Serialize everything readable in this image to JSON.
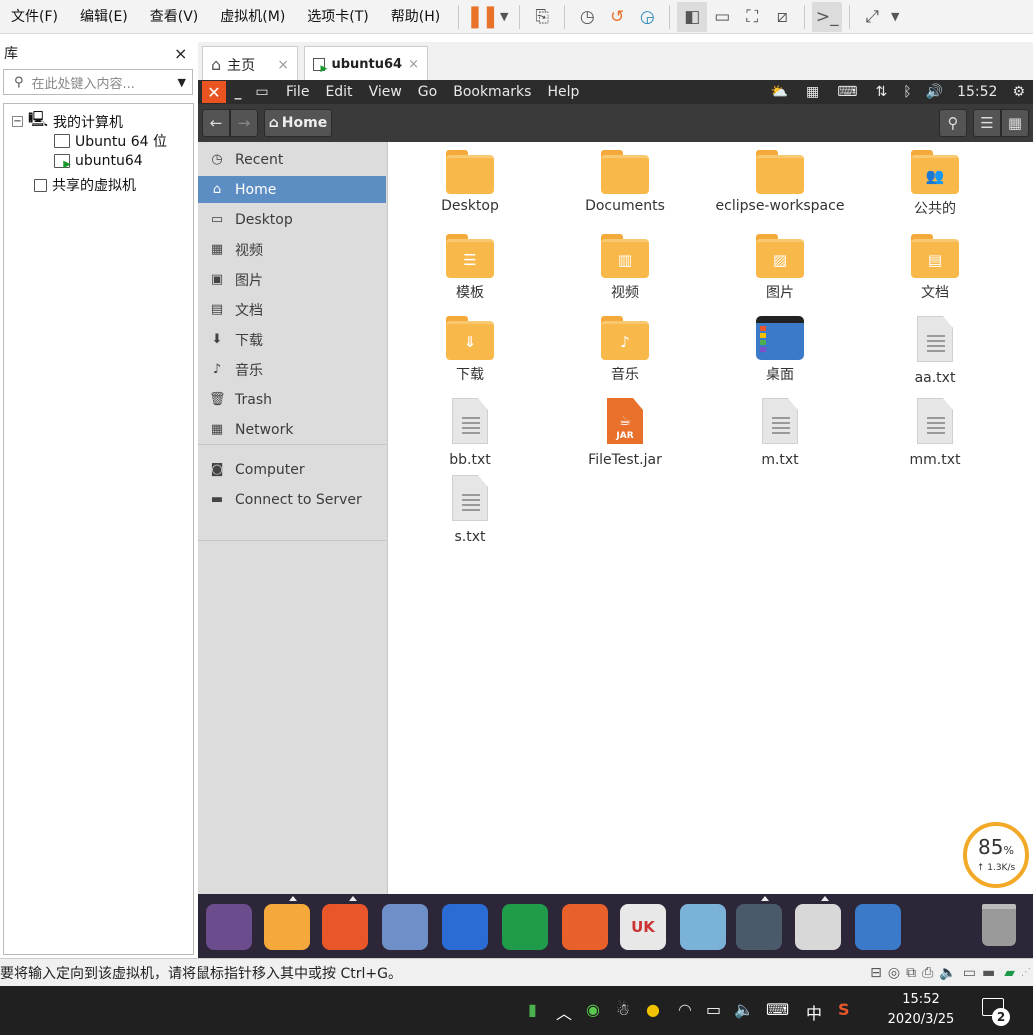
{
  "vm_menu": [
    "文件(F)",
    "编辑(E)",
    "查看(V)",
    "虚拟机(M)",
    "选项卡(T)",
    "帮助(H)"
  ],
  "library": {
    "title": "库",
    "close": "×",
    "search_placeholder": "在此处键入内容...",
    "tree": {
      "root": "我的计算机",
      "vm1": "Ubuntu 64 位",
      "vm2": "ubuntu64",
      "shared": "共享的虚拟机"
    }
  },
  "tabs": {
    "home": "主页",
    "vm": "ubuntu64",
    "close": "×"
  },
  "ubuntu": {
    "menus": [
      "File",
      "Edit",
      "View",
      "Go",
      "Bookmarks",
      "Help"
    ],
    "time": "15:52"
  },
  "nautilus": {
    "path_button": "Home",
    "sidebar": [
      {
        "label": "Recent",
        "icon": "clock-icon",
        "glyph": "◷"
      },
      {
        "label": "Home",
        "icon": "home-icon",
        "glyph": "⌂",
        "active": true
      },
      {
        "label": "Desktop",
        "icon": "desktop-icon",
        "glyph": "▭"
      },
      {
        "label": "视频",
        "icon": "film-icon",
        "glyph": "▦"
      },
      {
        "label": "图片",
        "icon": "image-icon",
        "glyph": "▣"
      },
      {
        "label": "文档",
        "icon": "document-icon",
        "glyph": "▤"
      },
      {
        "label": "下载",
        "icon": "download-icon",
        "glyph": "⬇"
      },
      {
        "label": "音乐",
        "icon": "music-icon",
        "glyph": "♪"
      },
      {
        "label": "Trash",
        "icon": "trash-icon",
        "glyph": "🗑"
      },
      {
        "label": "Network",
        "icon": "network-icon",
        "glyph": "▦"
      },
      {
        "label": "Computer",
        "icon": "computer-icon",
        "glyph": "◙"
      },
      {
        "label": "Connect to Server",
        "icon": "server-icon",
        "glyph": "▬"
      }
    ],
    "files": [
      {
        "name": "Desktop",
        "kind": "folder",
        "emblem": ""
      },
      {
        "name": "Documents",
        "kind": "folder",
        "emblem": ""
      },
      {
        "name": "eclipse-workspace",
        "kind": "folder",
        "emblem": ""
      },
      {
        "name": "公共的",
        "kind": "folder",
        "emblem": "👥"
      },
      {
        "name": "模板",
        "kind": "folder",
        "emblem": "☰"
      },
      {
        "name": "视频",
        "kind": "folder",
        "emblem": "▥"
      },
      {
        "name": "图片",
        "kind": "folder",
        "emblem": "▨"
      },
      {
        "name": "文档",
        "kind": "folder",
        "emblem": "▤"
      },
      {
        "name": "下载",
        "kind": "folder",
        "emblem": "⇓"
      },
      {
        "name": "音乐",
        "kind": "folder",
        "emblem": "♪"
      },
      {
        "name": "桌面",
        "kind": "desktop",
        "emblem": ""
      },
      {
        "name": "aa.txt",
        "kind": "txt",
        "emblem": ""
      },
      {
        "name": "bb.txt",
        "kind": "txt",
        "emblem": ""
      },
      {
        "name": "FileTest.jar",
        "kind": "jar",
        "emblem": "JAR"
      },
      {
        "name": "m.txt",
        "kind": "txt",
        "emblem": ""
      },
      {
        "name": "mm.txt",
        "kind": "txt",
        "emblem": ""
      },
      {
        "name": "s.txt",
        "kind": "txt",
        "emblem": ""
      }
    ]
  },
  "dock": [
    {
      "name": "ubuntu-launcher",
      "color": "#6b4c8c"
    },
    {
      "name": "files",
      "color": "#f6a93b"
    },
    {
      "name": "firefox",
      "color": "#e8562a"
    },
    {
      "name": "chromium",
      "color": "#6f8fc8"
    },
    {
      "name": "word",
      "color": "#2b6cd4"
    },
    {
      "name": "excel",
      "color": "#1f9b4a"
    },
    {
      "name": "powerpoint",
      "color": "#e8602a"
    },
    {
      "name": "uk-software",
      "color": "#e8e8e8",
      "text": "UK"
    },
    {
      "name": "app-store",
      "color": "#7bb3d8"
    },
    {
      "name": "terminal",
      "color": "#4a5a6a"
    },
    {
      "name": "eclipse",
      "color": "#d8d8d8"
    },
    {
      "name": "workspace",
      "color": "#3a7ac8"
    }
  ],
  "status_text": "要将输入定向到该虚拟机，请将鼠标指针移入其中或按 Ctrl+G。",
  "speed": {
    "percent": "85",
    "unit": "%",
    "rate": "↑ 1.3K/s"
  },
  "taskbar": {
    "time": "15:52",
    "date": "2020/3/25",
    "ime": "中",
    "notif": "2"
  }
}
